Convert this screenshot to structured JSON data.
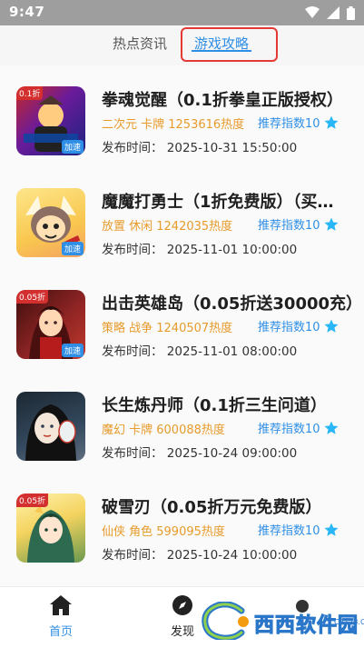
{
  "status_bar": {
    "time": "9:47"
  },
  "tabs": [
    {
      "label": "热点资讯",
      "active": false
    },
    {
      "label": "游戏攻略",
      "active": true
    }
  ],
  "games": [
    {
      "title": "拳魂觉醒（0.1折拳皇正版授权）",
      "tags": "二次元 卡牌 1253616热度",
      "recommend": "推荐指数10",
      "time": "发布时间：  2025-10-31 15:50:00",
      "icon": "kof-game-icon",
      "icon_discount": "0.1折",
      "icon_badge": "加速",
      "icon_colors": [
        "#c62828",
        "#1a237e"
      ]
    },
    {
      "title": "魔魔打勇士（1折免费版）（买…",
      "tags": "放置 休闲 1242035热度",
      "recommend": "推荐指数10",
      "time": "发布时间：  2025-11-01 10:00:00",
      "icon": "cartoon-warrior-icon",
      "icon_discount": "",
      "icon_badge": "加速",
      "icon_colors": [
        "#f9c74f",
        "#e76f51"
      ]
    },
    {
      "title": "出击英雄岛（0.05折送30000充）",
      "tags": "策略 战争 1240507热度",
      "recommend": "推荐指数10",
      "time": "发布时间：  2025-11-01 08:00:00",
      "icon": "heroine-icon",
      "icon_discount": "0.05折",
      "icon_badge": "加速",
      "icon_colors": [
        "#5d1a1a",
        "#c0392b"
      ]
    },
    {
      "title": "长生炼丹师（0.1折三生问道）",
      "tags": "魔幻 卡牌 600088热度",
      "recommend": "推荐指数10",
      "time": "发布时间：  2025-10-24 09:00:00",
      "icon": "mask-lady-icon",
      "icon_discount": "",
      "icon_badge": "",
      "icon_colors": [
        "#2c3e50",
        "#7f8c8d"
      ]
    },
    {
      "title": "破雪刃（0.05折万元免费版）",
      "tags": "仙侠 角色 599095热度",
      "recommend": "推荐指数10",
      "time": "发布时间：  2025-10-24 10:00:00",
      "icon": "fairy-icon",
      "icon_discount": "0.05折",
      "icon_badge": "",
      "icon_colors": [
        "#f4d35e",
        "#6a994e"
      ]
    }
  ],
  "bottom_nav": [
    {
      "label": "首页",
      "icon": "home-icon",
      "active": true
    },
    {
      "label": "发现",
      "icon": "discover-icon",
      "active": false
    }
  ],
  "watermark": {
    "text": "西西软件园",
    "sub": "CR173.COM"
  },
  "colors": {
    "accent": "#2f8fe6",
    "tag": "#e69b2b",
    "star": "#29b6f6",
    "highlight_box": "#e53935"
  }
}
